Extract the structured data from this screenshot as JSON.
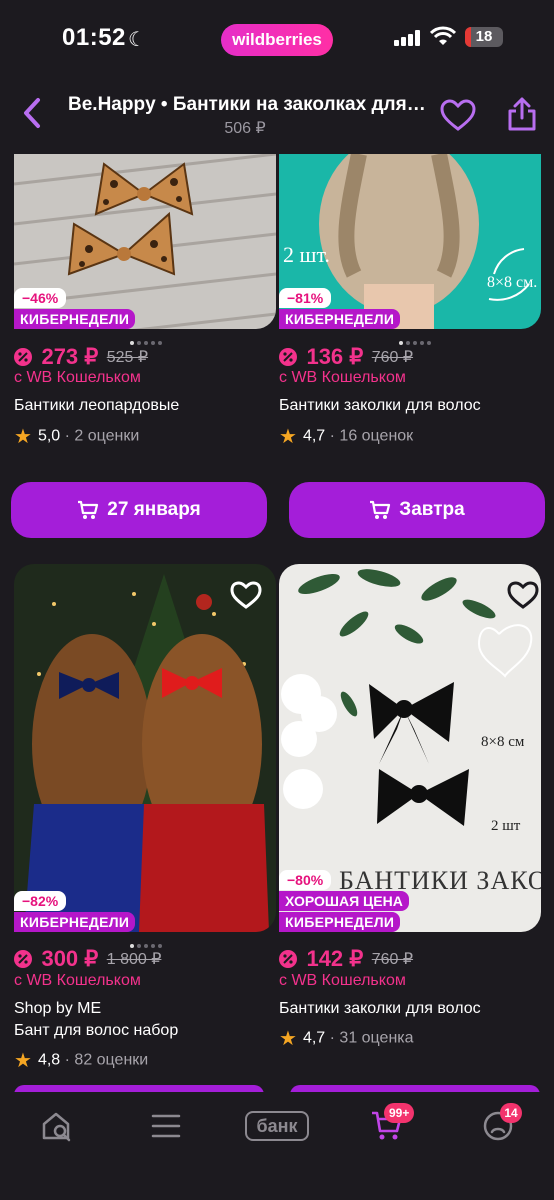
{
  "status": {
    "time": "01:52",
    "brand": "wildberries",
    "battery": "18"
  },
  "header": {
    "title": "Be.Happy • Бантики на заколках для волос",
    "subtitle": "506 ₽"
  },
  "products": [
    {
      "discount": "−46%",
      "promo": "КИБЕРНЕДЕЛИ",
      "price": "273 ₽",
      "old_price": "525 ₽",
      "wallet": "с WB Кошельком",
      "name": "Бантики леопардовые",
      "rating": "5,0",
      "reviews": "· 2 оценки",
      "cta": "27 января"
    },
    {
      "discount": "−81%",
      "promo": "КИБЕРНЕДЕЛИ",
      "price": "136 ₽",
      "old_price": "760 ₽",
      "wallet": "с WB Кошельком",
      "name": "Бантики заколки для волос",
      "rating": "4,7",
      "reviews": "· 16 оценок",
      "cta": "Завтра",
      "image_text": [
        "2 шт.",
        "8×8 см."
      ]
    },
    {
      "discount": "−82%",
      "promo": "КИБЕРНЕДЕЛИ",
      "price": "300 ₽",
      "old_price": "1 800 ₽",
      "wallet": "с WB Кошельком",
      "brand": "Shop by ME",
      "name": "Бант для волос набор",
      "rating": "4,8",
      "reviews": "· 82 оценки"
    },
    {
      "discount": "−80%",
      "tag": "ХОРОШАЯ ЦЕНА",
      "promo": "КИБЕРНЕДЕЛИ",
      "price": "142 ₽",
      "old_price": "760 ₽",
      "wallet": "с WB Кошельком",
      "name": "Бантики заколки для волос",
      "rating": "4,7",
      "reviews": "· 31 оценка",
      "image_text": [
        "8×8 см",
        "2 шт",
        "БАНТИКИ ЗАКОЛКИ"
      ]
    }
  ],
  "nav": {
    "bank": "банк",
    "cart_badge": "99+",
    "profile_badge": "14"
  },
  "colors": {
    "accent": "#a41ed9",
    "price": "#f3328c",
    "background": "#1c1a1f"
  }
}
